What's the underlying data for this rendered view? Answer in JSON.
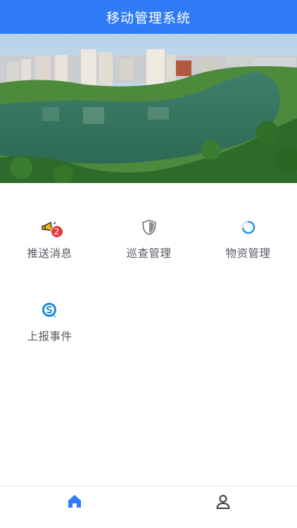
{
  "header": {
    "title": "移动管理系统"
  },
  "banner": {
    "description": ""
  },
  "menu": [
    {
      "label": "推送消息",
      "icon": "megaphone-icon",
      "badge": "2"
    },
    {
      "label": "巡查管理",
      "icon": "shield-icon"
    },
    {
      "label": "物资管理",
      "icon": "loading-ring-icon"
    },
    {
      "label": "上报事件",
      "icon": "report-s-icon"
    }
  ],
  "tabbar": {
    "items": [
      {
        "icon": "home-icon",
        "active": true
      },
      {
        "icon": "user-icon",
        "active": false
      }
    ]
  },
  "colors": {
    "primary": "#2f7bf5",
    "badge": "#e8383d",
    "label": "#555a60"
  }
}
